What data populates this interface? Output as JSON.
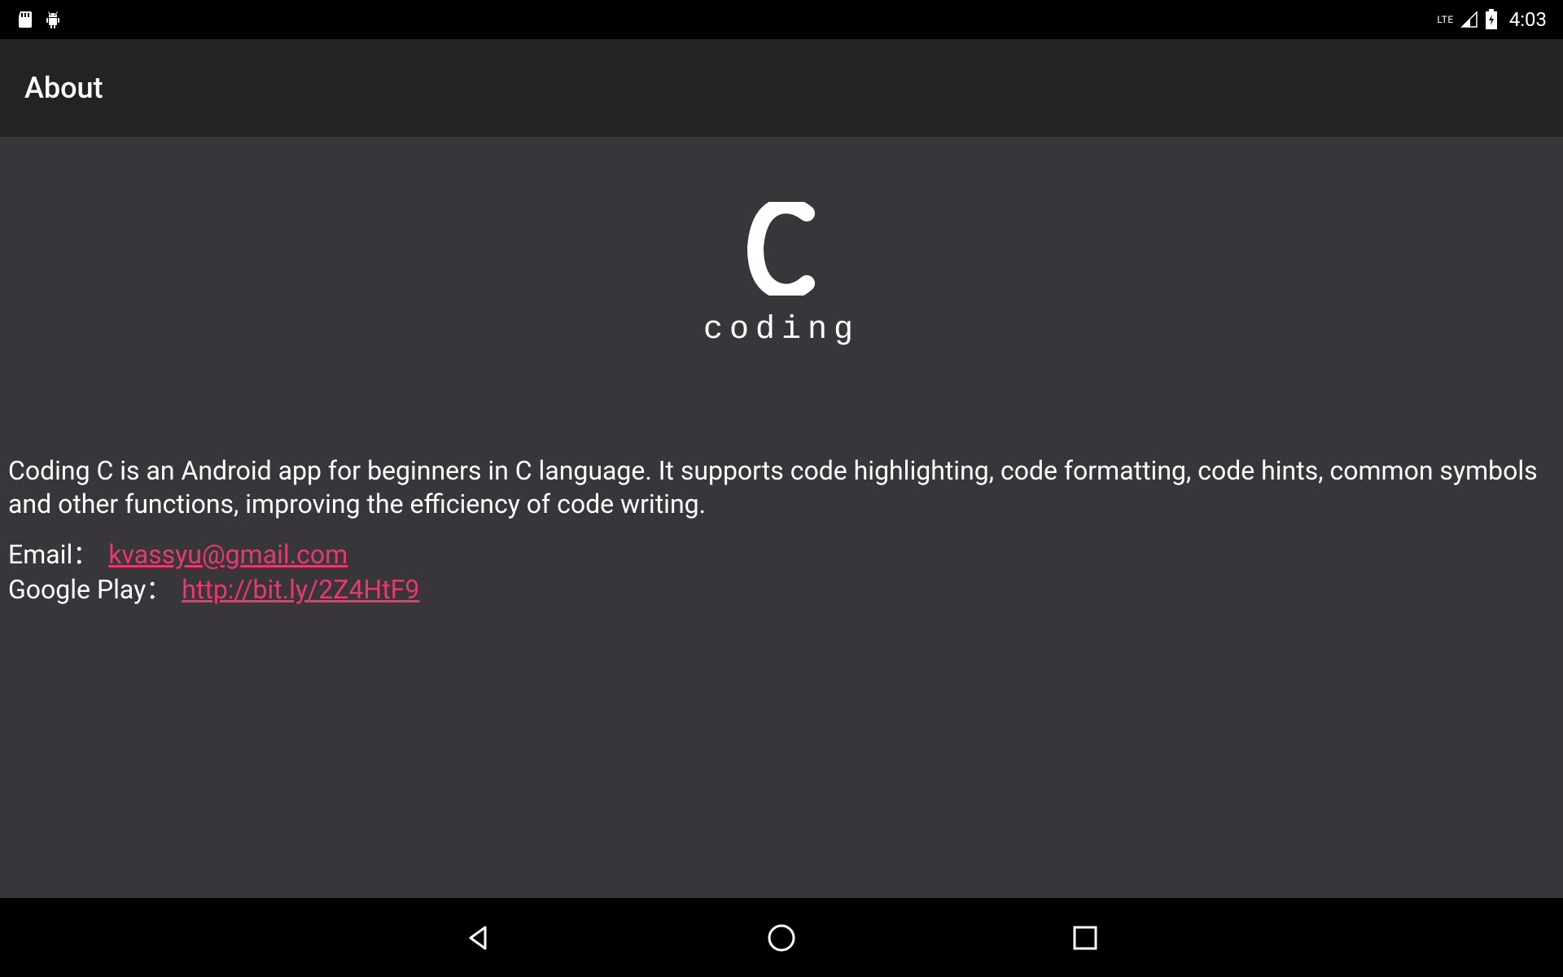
{
  "status_bar": {
    "lte_label": "LTE",
    "time": "4:03"
  },
  "app_bar": {
    "title": "About"
  },
  "content": {
    "logo_text": "coding",
    "description": "Coding C is an Android app for beginners in C language. It supports code highlighting, code formatting, code hints, common symbols and other functions, improving the efficiency of code writing.",
    "email_label": "Email：",
    "email_link": "kvassyu@gmail.com",
    "google_play_label": "Google Play：",
    "google_play_link": "http://bit.ly/2Z4HtF9"
  }
}
